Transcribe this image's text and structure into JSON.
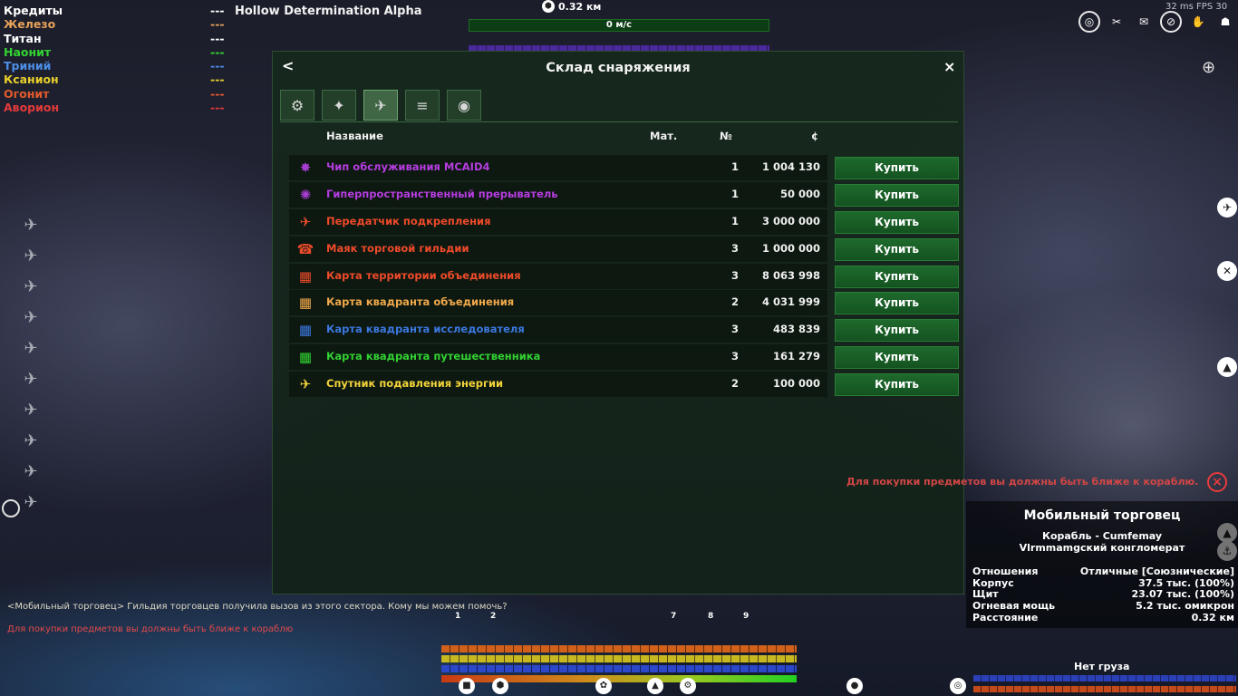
{
  "resources": [
    {
      "label": "Кредиты",
      "value": "---",
      "color": "#ffffff"
    },
    {
      "label": "Железо",
      "value": "---",
      "color": "#e6a15a"
    },
    {
      "label": "Титан",
      "value": "---",
      "color": "#ffffff"
    },
    {
      "label": "Наонит",
      "value": "---",
      "color": "#33d433"
    },
    {
      "label": "Триний",
      "value": "---",
      "color": "#4c8fe6"
    },
    {
      "label": "Ксанион",
      "value": "---",
      "color": "#e8cf2c"
    },
    {
      "label": "Огонит",
      "value": "---",
      "color": "#e25a2a"
    },
    {
      "label": "Аворион",
      "value": "---",
      "color": "#e23a3a"
    }
  ],
  "sector_name": "Hollow Determination Alpha",
  "top_hud": {
    "distance": "0.32 км",
    "speed": "0 м/с",
    "fps": "32 ms FPS 30"
  },
  "panel": {
    "title": "Склад снаряжения",
    "back_label": "<",
    "close_label": "×",
    "tabs": [
      {
        "icon": "turret-icon",
        "glyph": "⚙"
      },
      {
        "icon": "arms-icon",
        "glyph": "✦"
      },
      {
        "icon": "satellite-icon",
        "glyph": "✈"
      },
      {
        "icon": "stack-icon",
        "glyph": "≡"
      },
      {
        "icon": "torpedo-icon",
        "glyph": "◉"
      }
    ],
    "columns": {
      "name": "Название",
      "mat": "Мат.",
      "num": "№",
      "price": "¢"
    },
    "items": [
      {
        "name": "Чип обслуживания MCAID4",
        "num": "1",
        "price": "1 004 130",
        "color": "#b63de0",
        "icon": "✸",
        "icon_color": "#a63dd0"
      },
      {
        "name": "Гиперпространственный прерыватель",
        "num": "1",
        "price": "50 000",
        "color": "#b63de0",
        "icon": "✺",
        "icon_color": "#a63dd0"
      },
      {
        "name": "Передатчик подкрепления",
        "num": "1",
        "price": "3 000 000",
        "color": "#ef4a2a",
        "icon": "✈",
        "icon_color": "#e84a2a"
      },
      {
        "name": "Маяк торговой гильдии",
        "num": "3",
        "price": "1 000 000",
        "color": "#ef4a2a",
        "icon": "☎",
        "icon_color": "#e84a2a"
      },
      {
        "name": "Карта территории объединения",
        "num": "3",
        "price": "8 063 998",
        "color": "#ef4a2a",
        "icon": "▦",
        "icon_color": "#e84a2a"
      },
      {
        "name": "Карта квадранта объединения",
        "num": "2",
        "price": "4 031 999",
        "color": "#f0a84a",
        "icon": "▦",
        "icon_color": "#f0a84a"
      },
      {
        "name": "Карта квадранта исследователя",
        "num": "3",
        "price": "483 839",
        "color": "#3c78e0",
        "icon": "▦",
        "icon_color": "#3c78e0"
      },
      {
        "name": "Карта квадранта путешественника",
        "num": "3",
        "price": "161 279",
        "color": "#32d232",
        "icon": "▦",
        "icon_color": "#32d232"
      },
      {
        "name": "Спутник подавления энергии",
        "num": "2",
        "price": "100 000",
        "color": "#f2d23a",
        "icon": "✈",
        "icon_color": "#f2d23a"
      }
    ],
    "buy_label": "Купить"
  },
  "warning": "Для покупки предметов вы должны быть ближе к кораблю.",
  "target": {
    "title": "Мобильный торговец",
    "ship": "Корабль - Cumfemay",
    "faction": "Vlrmmamgский конгломерат",
    "rows": [
      {
        "label": "Отношения",
        "value": "Отличные [Союзнические]"
      },
      {
        "label": "Корпус",
        "value": "37.5 тыс. (100%)"
      },
      {
        "label": "Щит",
        "value": "23.07 тыс. (100%)"
      },
      {
        "label": "Огневая мощь",
        "value": "5.2 тыс. омикрон"
      },
      {
        "label": "Расстояние",
        "value": "0.32 км"
      }
    ],
    "cargo": "Нет груза"
  },
  "chat": {
    "line1": "<Мобильный торговец> Гильдия торговцев получила вызов из этого сектора. Кому мы можем помочь?",
    "line2": "Для покупки предметов вы должны быть ближе к кораблю"
  },
  "hotbar_slots": [
    "1",
    "2",
    "7",
    "8",
    "9"
  ]
}
